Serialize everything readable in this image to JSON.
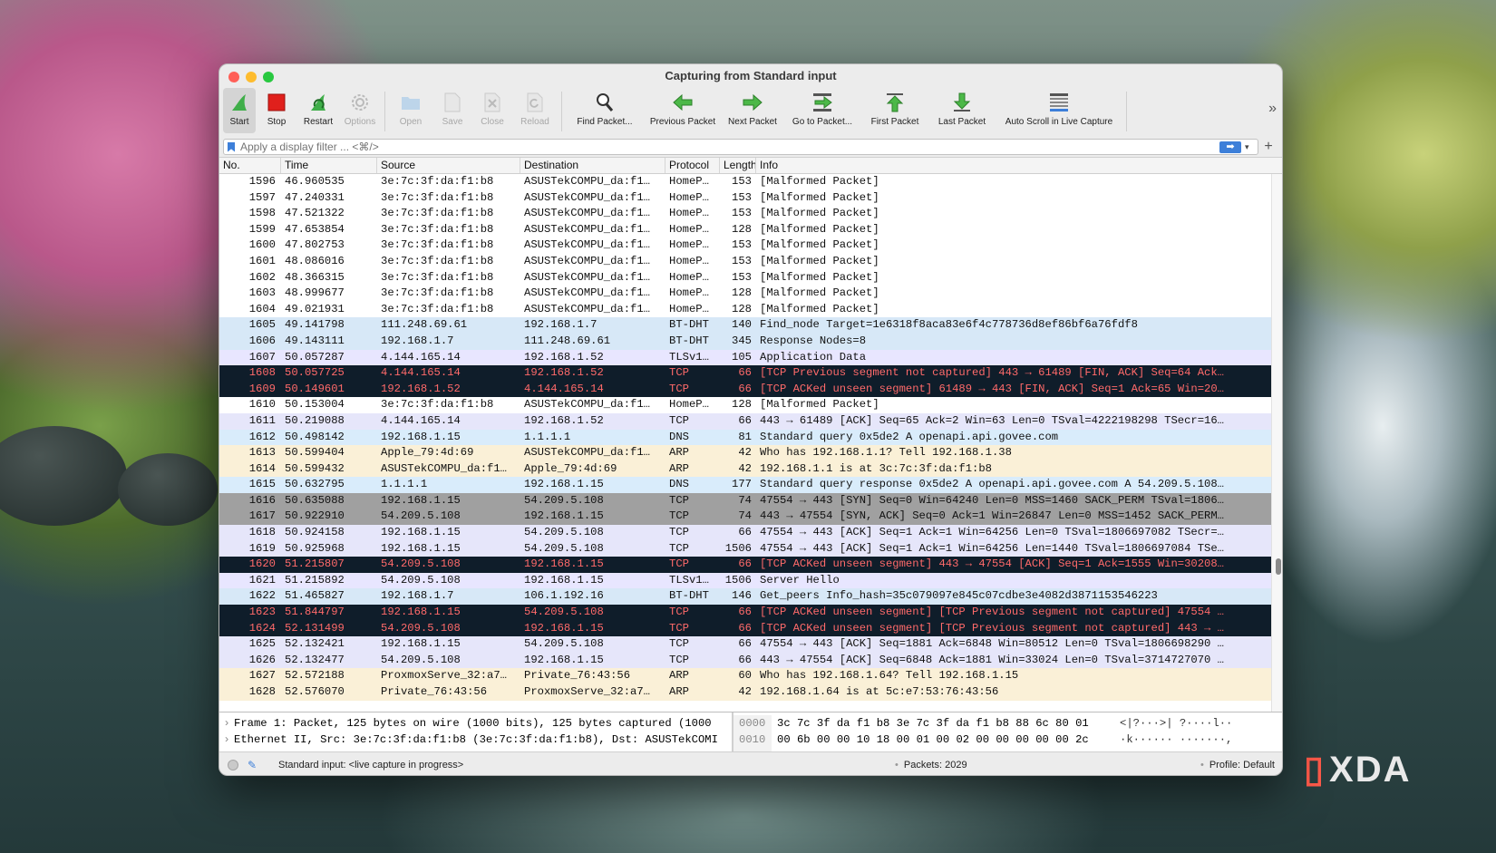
{
  "window": {
    "title": "Capturing from Standard input"
  },
  "toolbar": [
    {
      "label": "Start",
      "icon": "shark-fin-icon",
      "state": "active"
    },
    {
      "label": "Stop",
      "icon": "stop-icon",
      "state": "enabled"
    },
    {
      "label": "Restart",
      "icon": "restart-fin-icon",
      "state": "enabled"
    },
    {
      "label": "Options",
      "icon": "gear-icon",
      "state": "disabled"
    },
    {
      "label": "Open",
      "icon": "folder-icon",
      "state": "disabled"
    },
    {
      "label": "Save",
      "icon": "document-icon",
      "state": "disabled"
    },
    {
      "label": "Close",
      "icon": "close-document-icon",
      "state": "disabled"
    },
    {
      "label": "Reload",
      "icon": "reload-icon",
      "state": "disabled"
    },
    {
      "label": "Find Packet...",
      "icon": "magnifier-icon",
      "state": "enabled"
    },
    {
      "label": "Previous Packet",
      "icon": "arrow-left-icon",
      "state": "enabled"
    },
    {
      "label": "Next Packet",
      "icon": "arrow-right-icon",
      "state": "enabled"
    },
    {
      "label": "Go to Packet...",
      "icon": "goto-arrow-icon",
      "state": "enabled"
    },
    {
      "label": "First Packet",
      "icon": "arrow-top-icon",
      "state": "enabled"
    },
    {
      "label": "Last Packet",
      "icon": "arrow-bottom-icon",
      "state": "enabled"
    },
    {
      "label": "Auto Scroll in Live Capture",
      "icon": "autoscroll-icon",
      "state": "enabled"
    }
  ],
  "filter": {
    "placeholder": "Apply a display filter ... <⌘/>",
    "go_label": "➡",
    "dropdown": "▾",
    "add": "+",
    "more": "»"
  },
  "columns": [
    "No.",
    "Time",
    "Source",
    "Destination",
    "Protocol",
    "Length",
    "Info"
  ],
  "colors": {
    "malformed": "#ffffff",
    "bt": "#d7e8f7",
    "tls": "#e8e6ff",
    "dark": "#0f1d2a",
    "dark_text": "#ff6a6a",
    "tcp": "#e6e6fa",
    "dns": "#d9ecfb",
    "arp": "#faf0d7",
    "syn": "#a0a0a0",
    "traffic_red": "#ff5f57",
    "traffic_yellow": "#febc2e",
    "traffic_green": "#28c840"
  },
  "packets": [
    {
      "no": "1596",
      "time": "46.960535",
      "src": "3e:7c:3f:da:f1:b8",
      "dst": "ASUSTekCOMPU_da:f1…",
      "proto": "HomeP…",
      "len": "153",
      "info": "[Malformed Packet]",
      "style": "malformed"
    },
    {
      "no": "1597",
      "time": "47.240331",
      "src": "3e:7c:3f:da:f1:b8",
      "dst": "ASUSTekCOMPU_da:f1…",
      "proto": "HomeP…",
      "len": "153",
      "info": "[Malformed Packet]",
      "style": "malformed"
    },
    {
      "no": "1598",
      "time": "47.521322",
      "src": "3e:7c:3f:da:f1:b8",
      "dst": "ASUSTekCOMPU_da:f1…",
      "proto": "HomeP…",
      "len": "153",
      "info": "[Malformed Packet]",
      "style": "malformed"
    },
    {
      "no": "1599",
      "time": "47.653854",
      "src": "3e:7c:3f:da:f1:b8",
      "dst": "ASUSTekCOMPU_da:f1…",
      "proto": "HomeP…",
      "len": "128",
      "info": "[Malformed Packet]",
      "style": "malformed"
    },
    {
      "no": "1600",
      "time": "47.802753",
      "src": "3e:7c:3f:da:f1:b8",
      "dst": "ASUSTekCOMPU_da:f1…",
      "proto": "HomeP…",
      "len": "153",
      "info": "[Malformed Packet]",
      "style": "malformed"
    },
    {
      "no": "1601",
      "time": "48.086016",
      "src": "3e:7c:3f:da:f1:b8",
      "dst": "ASUSTekCOMPU_da:f1…",
      "proto": "HomeP…",
      "len": "153",
      "info": "[Malformed Packet]",
      "style": "malformed"
    },
    {
      "no": "1602",
      "time": "48.366315",
      "src": "3e:7c:3f:da:f1:b8",
      "dst": "ASUSTekCOMPU_da:f1…",
      "proto": "HomeP…",
      "len": "153",
      "info": "[Malformed Packet]",
      "style": "malformed"
    },
    {
      "no": "1603",
      "time": "48.999677",
      "src": "3e:7c:3f:da:f1:b8",
      "dst": "ASUSTekCOMPU_da:f1…",
      "proto": "HomeP…",
      "len": "128",
      "info": "[Malformed Packet]",
      "style": "malformed"
    },
    {
      "no": "1604",
      "time": "49.021931",
      "src": "3e:7c:3f:da:f1:b8",
      "dst": "ASUSTekCOMPU_da:f1…",
      "proto": "HomeP…",
      "len": "128",
      "info": "[Malformed Packet]",
      "style": "malformed"
    },
    {
      "no": "1605",
      "time": "49.141798",
      "src": "111.248.69.61",
      "dst": "192.168.1.7",
      "proto": "BT-DHT",
      "len": "140",
      "info": "Find_node Target=1e6318f8aca83e6f4c778736d8ef86bf6a76fdf8",
      "style": "bt"
    },
    {
      "no": "1606",
      "time": "49.143111",
      "src": "192.168.1.7",
      "dst": "111.248.69.61",
      "proto": "BT-DHT",
      "len": "345",
      "info": "Response Nodes=8",
      "style": "bt"
    },
    {
      "no": "1607",
      "time": "50.057287",
      "src": "4.144.165.14",
      "dst": "192.168.1.52",
      "proto": "TLSv1…",
      "len": "105",
      "info": "Application Data",
      "style": "tls"
    },
    {
      "no": "1608",
      "time": "50.057725",
      "src": "4.144.165.14",
      "dst": "192.168.1.52",
      "proto": "TCP",
      "len": "66",
      "info": "[TCP Previous segment not captured] 443 → 61489 [FIN, ACK] Seq=64 Ack…",
      "style": "dark"
    },
    {
      "no": "1609",
      "time": "50.149601",
      "src": "192.168.1.52",
      "dst": "4.144.165.14",
      "proto": "TCP",
      "len": "66",
      "info": "[TCP ACKed unseen segment] 61489 → 443 [FIN, ACK] Seq=1 Ack=65 Win=20…",
      "style": "dark"
    },
    {
      "no": "1610",
      "time": "50.153004",
      "src": "3e:7c:3f:da:f1:b8",
      "dst": "ASUSTekCOMPU_da:f1…",
      "proto": "HomeP…",
      "len": "128",
      "info": "[Malformed Packet]",
      "style": "malformed"
    },
    {
      "no": "1611",
      "time": "50.219088",
      "src": "4.144.165.14",
      "dst": "192.168.1.52",
      "proto": "TCP",
      "len": "66",
      "info": "443 → 61489 [ACK] Seq=65 Ack=2 Win=63 Len=0 TSval=4222198298 TSecr=16…",
      "style": "tcp"
    },
    {
      "no": "1612",
      "time": "50.498142",
      "src": "192.168.1.15",
      "dst": "1.1.1.1",
      "proto": "DNS",
      "len": "81",
      "info": "Standard query 0x5de2 A openapi.api.govee.com",
      "style": "dns"
    },
    {
      "no": "1613",
      "time": "50.599404",
      "src": "Apple_79:4d:69",
      "dst": "ASUSTekCOMPU_da:f1…",
      "proto": "ARP",
      "len": "42",
      "info": "Who has 192.168.1.1? Tell 192.168.1.38",
      "style": "arp"
    },
    {
      "no": "1614",
      "time": "50.599432",
      "src": "ASUSTekCOMPU_da:f1…",
      "dst": "Apple_79:4d:69",
      "proto": "ARP",
      "len": "42",
      "info": "192.168.1.1 is at 3c:7c:3f:da:f1:b8",
      "style": "arp"
    },
    {
      "no": "1615",
      "time": "50.632795",
      "src": "1.1.1.1",
      "dst": "192.168.1.15",
      "proto": "DNS",
      "len": "177",
      "info": "Standard query response 0x5de2 A openapi.api.govee.com A 54.209.5.108…",
      "style": "dns"
    },
    {
      "no": "1616",
      "time": "50.635088",
      "src": "192.168.1.15",
      "dst": "54.209.5.108",
      "proto": "TCP",
      "len": "74",
      "info": "47554 → 443 [SYN] Seq=0 Win=64240 Len=0 MSS=1460 SACK_PERM TSval=1806…",
      "style": "syn"
    },
    {
      "no": "1617",
      "time": "50.922910",
      "src": "54.209.5.108",
      "dst": "192.168.1.15",
      "proto": "TCP",
      "len": "74",
      "info": "443 → 47554 [SYN, ACK] Seq=0 Ack=1 Win=26847 Len=0 MSS=1452 SACK_PERM…",
      "style": "syn"
    },
    {
      "no": "1618",
      "time": "50.924158",
      "src": "192.168.1.15",
      "dst": "54.209.5.108",
      "proto": "TCP",
      "len": "66",
      "info": "47554 → 443 [ACK] Seq=1 Ack=1 Win=64256 Len=0 TSval=1806697082 TSecr=…",
      "style": "tcp"
    },
    {
      "no": "1619",
      "time": "50.925968",
      "src": "192.168.1.15",
      "dst": "54.209.5.108",
      "proto": "TCP",
      "len": "1506",
      "info": "47554 → 443 [ACK] Seq=1 Ack=1 Win=64256 Len=1440 TSval=1806697084 TSe…",
      "style": "tcp"
    },
    {
      "no": "1620",
      "time": "51.215807",
      "src": "54.209.5.108",
      "dst": "192.168.1.15",
      "proto": "TCP",
      "len": "66",
      "info": "[TCP ACKed unseen segment] 443 → 47554 [ACK] Seq=1 Ack=1555 Win=30208…",
      "style": "dark"
    },
    {
      "no": "1621",
      "time": "51.215892",
      "src": "54.209.5.108",
      "dst": "192.168.1.15",
      "proto": "TLSv1…",
      "len": "1506",
      "info": "Server Hello",
      "style": "tls"
    },
    {
      "no": "1622",
      "time": "51.465827",
      "src": "192.168.1.7",
      "dst": "106.1.192.16",
      "proto": "BT-DHT",
      "len": "146",
      "info": "Get_peers Info_hash=35c079097e845c07cdbe3e4082d3871153546223",
      "style": "bt"
    },
    {
      "no": "1623",
      "time": "51.844797",
      "src": "192.168.1.15",
      "dst": "54.209.5.108",
      "proto": "TCP",
      "len": "66",
      "info": "[TCP ACKed unseen segment] [TCP Previous segment not captured] 47554 …",
      "style": "dark"
    },
    {
      "no": "1624",
      "time": "52.131499",
      "src": "54.209.5.108",
      "dst": "192.168.1.15",
      "proto": "TCP",
      "len": "66",
      "info": "[TCP ACKed unseen segment] [TCP Previous segment not captured] 443 → …",
      "style": "dark"
    },
    {
      "no": "1625",
      "time": "52.132421",
      "src": "192.168.1.15",
      "dst": "54.209.5.108",
      "proto": "TCP",
      "len": "66",
      "info": "47554 → 443 [ACK] Seq=1881 Ack=6848 Win=80512 Len=0 TSval=1806698290 …",
      "style": "tcp"
    },
    {
      "no": "1626",
      "time": "52.132477",
      "src": "54.209.5.108",
      "dst": "192.168.1.15",
      "proto": "TCP",
      "len": "66",
      "info": "443 → 47554 [ACK] Seq=6848 Ack=1881 Win=33024 Len=0 TSval=3714727070 …",
      "style": "tcp"
    },
    {
      "no": "1627",
      "time": "52.572188",
      "src": "ProxmoxServe_32:a7…",
      "dst": "Private_76:43:56",
      "proto": "ARP",
      "len": "60",
      "info": "Who has 192.168.1.64? Tell 192.168.1.15",
      "style": "arp"
    },
    {
      "no": "1628",
      "time": "52.576070",
      "src": "Private_76:43:56",
      "dst": "ProxmoxServe_32:a7…",
      "proto": "ARP",
      "len": "42",
      "info": "192.168.1.64 is at 5c:e7:53:76:43:56",
      "style": "arp"
    }
  ],
  "details": [
    {
      "chevron": "›",
      "text": "Frame 1: Packet, 125 bytes on wire (1000 bits), 125 bytes captured (1000"
    },
    {
      "chevron": "›",
      "text": "Ethernet II, Src: 3e:7c:3f:da:f1:b8 (3e:7c:3f:da:f1:b8), Dst: ASUSTekCOMI"
    }
  ],
  "hex": [
    {
      "offset": "0000",
      "bytes": "3c 7c 3f da f1 b8 3e 7c  3f da f1 b8 88 6c 80 01",
      "ascii": "<|?···>| ?····l··"
    },
    {
      "offset": "0010",
      "bytes": "00 6b 00 00 10 18 00 01  00 02 00 00 00 00 00 2c",
      "ascii": "·k······ ·······,"
    }
  ],
  "status": {
    "message": "Standard input: <live capture in progress>",
    "packets": "Packets: 2029",
    "profile": "Profile: Default"
  },
  "watermark": "XDA"
}
